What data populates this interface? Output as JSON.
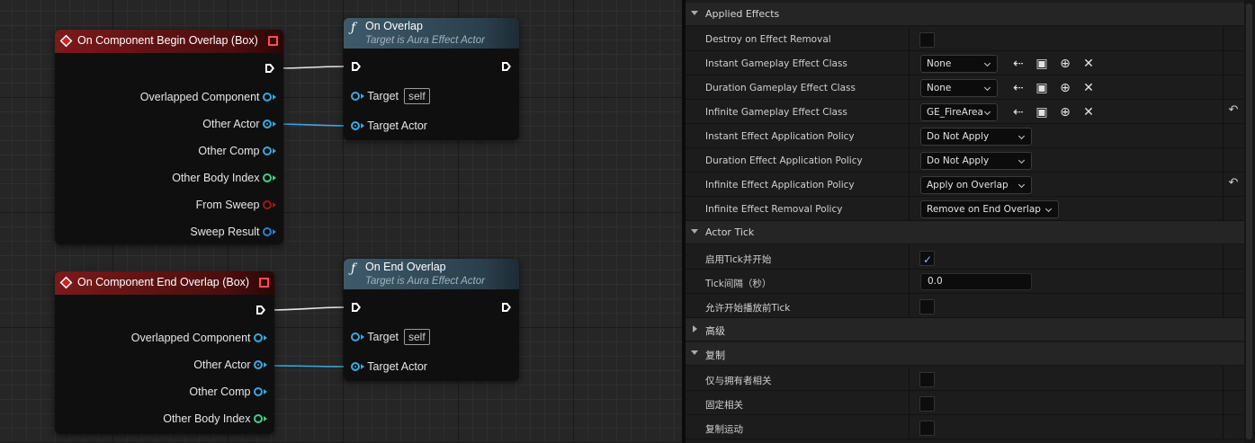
{
  "graph": {
    "nodes": {
      "begin_overlap": {
        "title": "On Component Begin Overlap (Box)",
        "pins": [
          "Overlapped Component",
          "Other Actor",
          "Other Comp",
          "Other Body Index",
          "From Sweep",
          "Sweep Result"
        ]
      },
      "on_overlap": {
        "title": "On Overlap",
        "subtitle": "Target is Aura Effect Actor",
        "target_label": "Target",
        "target_value": "self",
        "target_actor_label": "Target Actor"
      },
      "end_overlap": {
        "title": "On Component End Overlap (Box)",
        "pins": [
          "Overlapped Component",
          "Other Actor",
          "Other Comp",
          "Other Body Index"
        ]
      },
      "on_end_overlap": {
        "title": "On End Overlap",
        "subtitle": "Target is Aura Effect Actor",
        "target_label": "Target",
        "target_value": "self",
        "target_actor_label": "Target Actor"
      }
    },
    "colors": {
      "object_pin": "#3aa8e0",
      "int_pin": "#3fd08a",
      "bool_pin": "#a01818",
      "struct_pin": "#2f7fd0",
      "event_header": "#7a1a1a",
      "function_header": "#3e5a6a"
    }
  },
  "details": {
    "categories": {
      "applied_effects": "Applied Effects",
      "actor_tick": "Actor Tick",
      "advanced": "高级",
      "replication": "复制"
    },
    "properties": {
      "destroy_on_removal": {
        "label": "Destroy on Effect Removal"
      },
      "instant_class": {
        "label": "Instant Gameplay Effect Class",
        "value": "None"
      },
      "duration_class": {
        "label": "Duration Gameplay Effect Class",
        "value": "None"
      },
      "infinite_class": {
        "label": "Infinite Gameplay Effect Class",
        "value": "GE_FireArea"
      },
      "instant_policy": {
        "label": "Instant Effect Application Policy",
        "value": "Do Not Apply"
      },
      "duration_policy": {
        "label": "Duration Effect Application Policy",
        "value": "Do Not Apply"
      },
      "infinite_policy": {
        "label": "Infinite Effect Application Policy",
        "value": "Apply on Overlap"
      },
      "infinite_removal": {
        "label": "Infinite Effect Removal Policy",
        "value": "Remove on End Overlap"
      },
      "tick_start": {
        "label": "启用Tick并开始",
        "checked": true
      },
      "tick_interval": {
        "label": "Tick间隔（秒）",
        "value": "0.0"
      },
      "tick_before_play": {
        "label": "允许开始播放前Tick"
      },
      "only_owner": {
        "label": "仅与拥有者相关"
      },
      "always_relevant": {
        "label": "固定相关"
      },
      "replicate_movement": {
        "label": "复制运动"
      }
    },
    "icons": [
      "browse-back-arrow-icon",
      "browse-folder-icon",
      "add-icon",
      "clear-icon",
      "reset-to-default-icon",
      "checkmark-icon"
    ],
    "accent_color": "#9db0ff"
  }
}
